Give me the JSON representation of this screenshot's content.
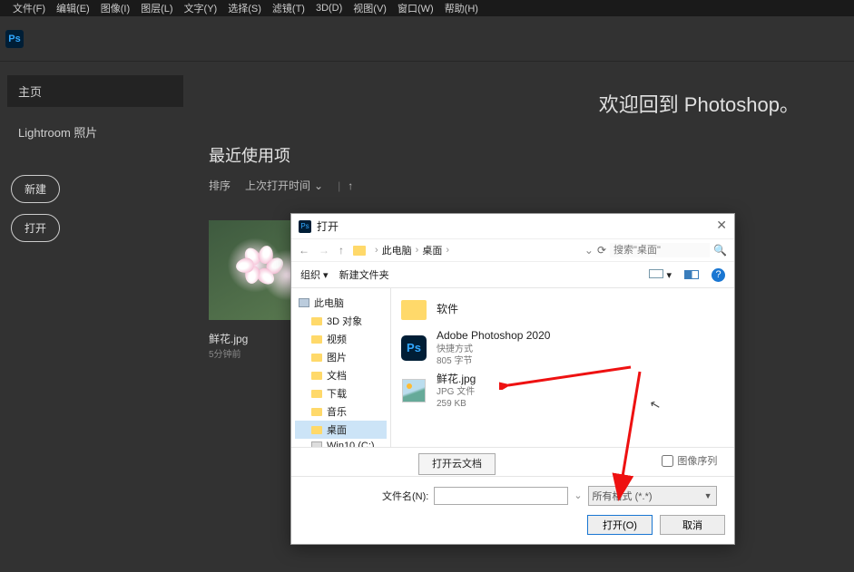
{
  "menu": [
    "文件(F)",
    "编辑(E)",
    "图像(I)",
    "图层(L)",
    "文字(Y)",
    "选择(S)",
    "滤镜(T)",
    "3D(D)",
    "视图(V)",
    "窗口(W)",
    "帮助(H)"
  ],
  "logo": "Ps",
  "side": {
    "home": "主页",
    "lightroom": "Lightroom 照片",
    "new_btn": "新建",
    "open_btn": "打开"
  },
  "main": {
    "welcome": "欢迎回到 Photoshop。",
    "recent": "最近使用项",
    "sort_label": "排序",
    "sort_value": "上次打开时间",
    "thumb": {
      "name": "鲜花.jpg",
      "time": "5分钟前"
    }
  },
  "dialog": {
    "title": "打开",
    "breadcrumb": [
      "此电脑",
      "桌面"
    ],
    "search_placeholder": "搜索\"桌面\"",
    "organize": "组织",
    "new_folder": "新建文件夹",
    "tree": {
      "this_pc": "此电脑",
      "items": [
        "3D 对象",
        "视频",
        "图片",
        "文档",
        "下载",
        "音乐",
        "桌面",
        "Win10 (C:)"
      ],
      "selected": "桌面"
    },
    "files": [
      {
        "name": "软件",
        "type": "folder",
        "sub1": "",
        "sub2": ""
      },
      {
        "name": "Adobe Photoshop 2020",
        "type": "ps",
        "sub1": "快捷方式",
        "sub2": "805 字节"
      },
      {
        "name": "鲜花.jpg",
        "type": "image",
        "sub1": "JPG 文件",
        "sub2": "259 KB"
      }
    ],
    "cloud_btn": "打开云文档",
    "seq_label": "图像序列",
    "filename_label": "文件名(N):",
    "filter": "所有格式 (*.*)",
    "open_btn": "打开(O)",
    "cancel_btn": "取消"
  }
}
